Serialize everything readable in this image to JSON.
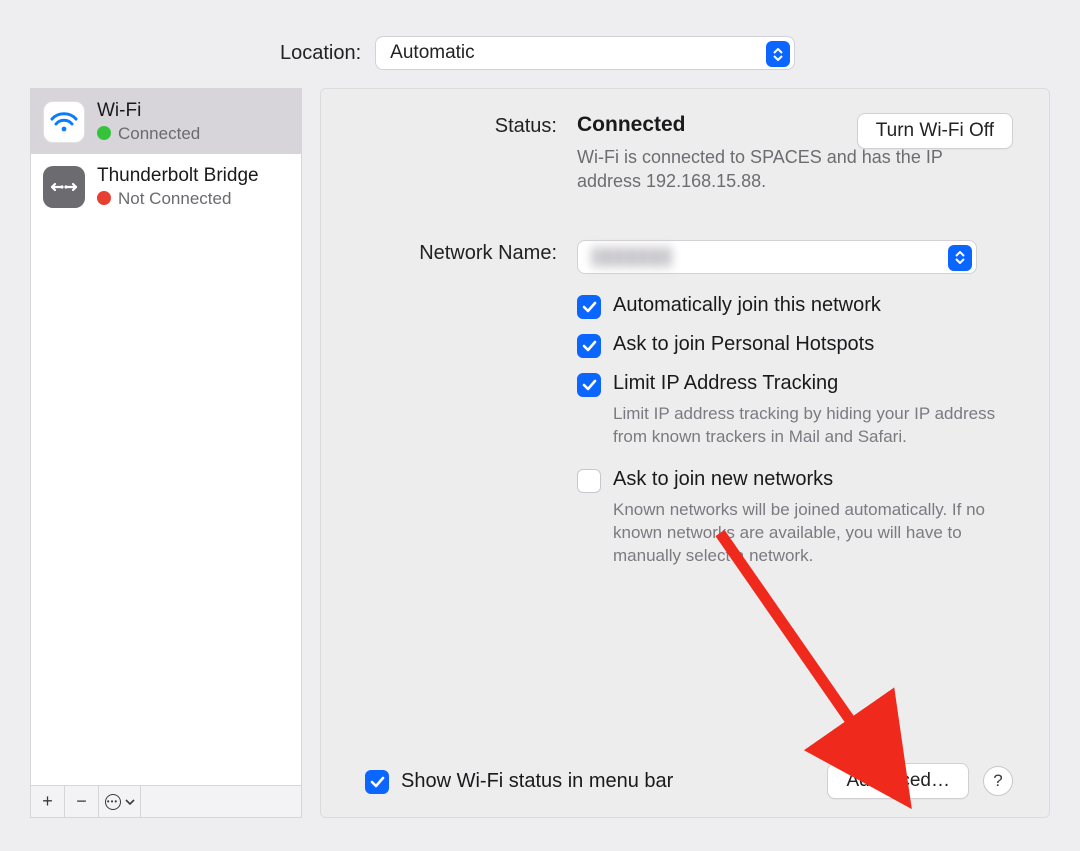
{
  "location": {
    "label": "Location:",
    "value": "Automatic"
  },
  "sidebar": {
    "items": [
      {
        "name": "Wi-Fi",
        "status": "Connected",
        "dot": "green",
        "icon": "wifi"
      },
      {
        "name": "Thunderbolt Bridge",
        "status": "Not Connected",
        "dot": "red",
        "icon": "thunderbolt-bridge"
      }
    ]
  },
  "status": {
    "label": "Status:",
    "value": "Connected",
    "desc": "Wi-Fi is connected to SPACES and has the IP address 192.168.15.88.",
    "turn_off_label": "Turn Wi-Fi Off"
  },
  "network": {
    "label": "Network Name:",
    "checkboxes": {
      "auto_join": {
        "label": "Automatically join this network",
        "checked": true
      },
      "ask_hotspot": {
        "label": "Ask to join Personal Hotspots",
        "checked": true
      },
      "limit_ip": {
        "label": "Limit IP Address Tracking",
        "checked": true,
        "desc": "Limit IP address tracking by hiding your IP address from known trackers in Mail and Safari."
      },
      "ask_new": {
        "label": "Ask to join new networks",
        "checked": false,
        "desc": "Known networks will be joined automatically. If no known networks are available, you will have to manually select a network."
      }
    }
  },
  "footer": {
    "show_status_label": "Show Wi-Fi status in menu bar",
    "show_status_checked": true,
    "advanced_label": "Advanced…",
    "help_label": "?"
  }
}
